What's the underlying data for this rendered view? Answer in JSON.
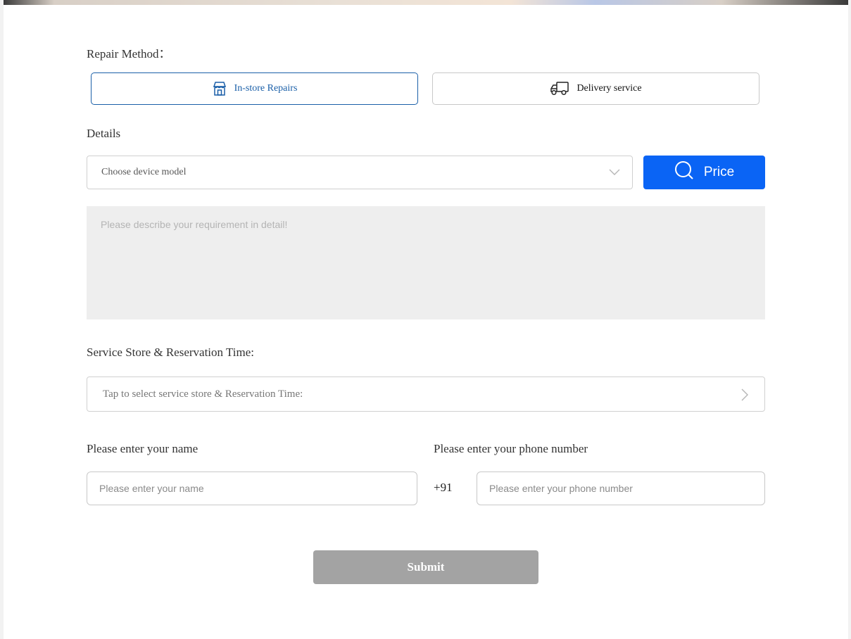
{
  "repair_method": {
    "label": "Repair Method：",
    "options": [
      {
        "label": "In-store Repairs",
        "selected": true,
        "icon": "store-icon"
      },
      {
        "label": "Delivery service",
        "selected": false,
        "icon": "truck-icon"
      }
    ]
  },
  "details": {
    "label": "Details",
    "device_select_placeholder": "Choose device model",
    "price_button_label": "Price",
    "description_placeholder": "Please describe your requirement in detail!"
  },
  "service_store": {
    "label": "Service Store & Reservation Time:",
    "select_placeholder": "Tap to select service store & Reservation Time:"
  },
  "contact": {
    "name_label": "Please enter your name",
    "name_placeholder": "Please enter your name",
    "phone_label": "Please enter your phone number",
    "phone_placeholder": "Please enter your phone number",
    "country_code": "+91"
  },
  "submit_label": "Submit",
  "colors": {
    "accent_blue": "#0a64f5",
    "selected_border": "#1a5fa8",
    "submit_disabled": "#a3a3a3",
    "description_bg": "#eeeeee"
  }
}
